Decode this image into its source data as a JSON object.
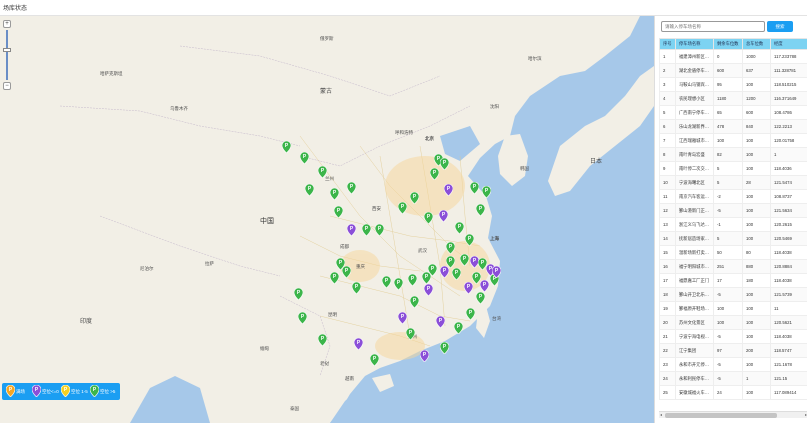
{
  "page": {
    "title": "场库状态"
  },
  "search": {
    "placeholder": "请输入停车场名称",
    "button_label": "搜索"
  },
  "table": {
    "headers": [
      "序号",
      "停车场名称",
      "剩余车位数",
      "总车位数",
      "经度"
    ],
    "rows": [
      [
        "1",
        "福建漳州新区…",
        "0",
        "1000",
        "117.233788"
      ],
      [
        "2",
        "湖北金盾停车…",
        "600",
        "637",
        "111.328781"
      ],
      [
        "3",
        "马鞍山马钢宾…",
        "95",
        "100",
        "118.510215"
      ],
      [
        "4",
        "农民理想小区",
        "1180",
        "1200",
        "116.371649"
      ],
      [
        "5",
        "广西南宁停车…",
        "65",
        "600",
        "108.4786"
      ],
      [
        "6",
        "乐山龙湖新界…",
        "478",
        "840",
        "122.2213"
      ],
      [
        "7",
        "江西瑞雅城市…",
        "100",
        "100",
        "120.01758"
      ],
      [
        "8",
        "南叶青岛宏盛",
        "82",
        "100",
        "1"
      ],
      [
        "9",
        "南叶停二次交…",
        "5",
        "100",
        "118.4036"
      ],
      [
        "10",
        "宁波海曙北区",
        "5",
        "28",
        "121.5474"
      ],
      [
        "11",
        "南京汽车客运…",
        "-2",
        "100",
        "108.8737"
      ],
      [
        "12",
        "鄞山港新门正…",
        "-5",
        "100",
        "121.5634"
      ],
      [
        "13",
        "浙江义乌飞达…",
        "-1",
        "100",
        "120.2615"
      ],
      [
        "14",
        "抚新居造场家…",
        "5",
        "100",
        "120.5469"
      ],
      [
        "15",
        "温新场新打卖…",
        "50",
        "80",
        "118.4038"
      ],
      [
        "16",
        "福宁明阳城市…",
        "251",
        "880",
        "120.8884"
      ],
      [
        "17",
        "福鼎嘉工厂正门",
        "17",
        "180",
        "118.4038"
      ],
      [
        "18",
        "鄞山开卫北乐…",
        "-5",
        "100",
        "121.5739"
      ],
      [
        "19",
        "鄞福原开鞋场…",
        "100",
        "100",
        "11"
      ],
      [
        "20",
        "苏州文化景区",
        "100",
        "100",
        "120.5621"
      ],
      [
        "21",
        "宁波宁海电视…",
        "-5",
        "100",
        "118.4038"
      ],
      [
        "22",
        "江宁集团",
        "97",
        "200",
        "118.5747"
      ],
      [
        "23",
        "永和市开元停…",
        "-5",
        "100",
        "121.1678"
      ],
      [
        "24",
        "永和利民停车…",
        "-5",
        "1",
        "121.15"
      ],
      [
        "25",
        "安徽城福火车…",
        "24",
        "100",
        "117.089414"
      ]
    ]
  },
  "legend": {
    "items": [
      {
        "label": "满场",
        "color": "#f5a623"
      },
      {
        "label": "空位<=0",
        "color": "#8b4fd8"
      },
      {
        "label": "空位 1-5",
        "color": "#f5d020"
      },
      {
        "label": "空位 >5",
        "color": "#3cb54a"
      }
    ]
  },
  "map": {
    "pin_letter": "P",
    "colors": {
      "water": "#a6c8e9",
      "land": "#f2efe6",
      "green": "#3cb54a",
      "purple": "#8b4fd8",
      "orange": "#f5a623",
      "yellow": "#f5d020"
    },
    "labels": {
      "russia": "俄罗斯",
      "mongolia": "蒙古",
      "kazakhstan": "哈萨克斯坦",
      "beijing": "北京",
      "shanghai": "上海",
      "china": "中国",
      "korea": "韩国",
      "japan": "日本",
      "india": "印度",
      "nepal": "尼泊尔",
      "myanmar": "缅甸",
      "laos": "老挝",
      "vietnam": "越南",
      "thailand": "泰国",
      "taiwan": "台湾",
      "chongqing": "重庆",
      "wuhan": "武汉",
      "xian": "西安",
      "chengdu": "成都",
      "guangzhou": "广州",
      "harbin": "哈尔滨",
      "shenyang": "沈阳",
      "lanzhou": "兰州",
      "lhasa": "拉萨",
      "urumqi": "乌鲁木齐",
      "kunming": "昆明",
      "huhhot": "呼和浩特"
    }
  }
}
